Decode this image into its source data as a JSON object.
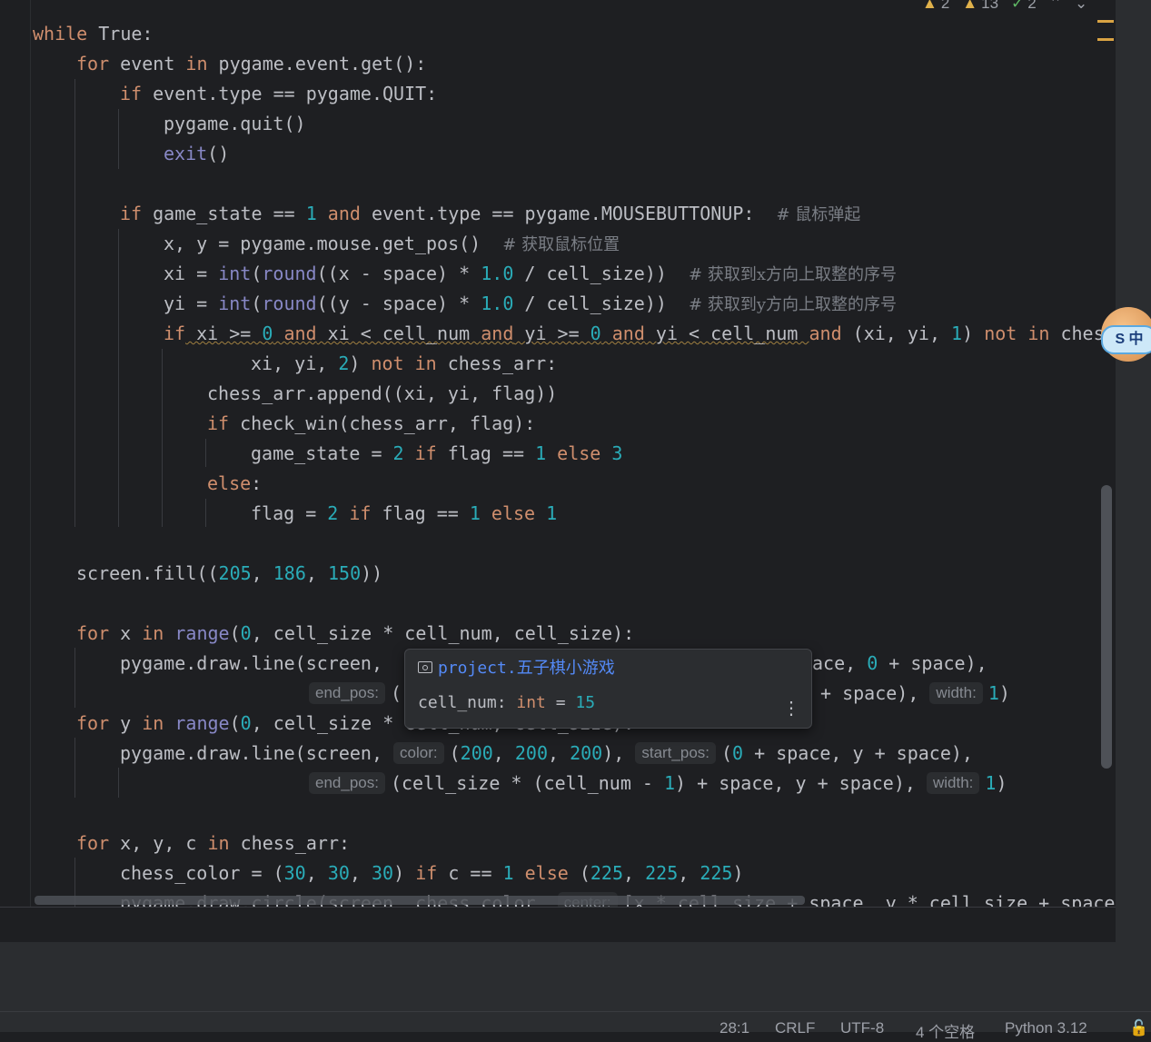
{
  "code": {
    "l1": {
      "kw": "while",
      "rest": " True:"
    },
    "l2": {
      "kw1": "for",
      "a": " event ",
      "kw2": "in",
      "b": " pygame.event.get():"
    },
    "l3": {
      "kw": "if",
      "rest": " event.type == pygame.QUIT:"
    },
    "l4": {
      "text": "pygame.quit()"
    },
    "l5": {
      "fn": "exit",
      "rest": "()"
    },
    "l6": {
      "kw": "if",
      "a": " game_state == ",
      "n": "1",
      "kw2": " and",
      "b": " event.type == pygame.MOUSEBUTTONUP:  ",
      "comment": "# 鼠标弹起"
    },
    "l7": {
      "text": "x, y = pygame.mouse.get_pos()  ",
      "comment": "# 获取鼠标位置"
    },
    "l8": {
      "a": "xi = ",
      "f1": "int",
      "p1": "(",
      "f2": "round",
      "b": "((x - space) * ",
      "n": "1.0",
      "c": " / cell_size))  ",
      "comment": "# 获取到x方向上取整的序号"
    },
    "l9": {
      "a": "yi = ",
      "f1": "int",
      "p1": "(",
      "f2": "round",
      "b": "((y - space) * ",
      "n": "1.0",
      "c": " / cell_size))  ",
      "comment": "# 获取到y方向上取整的序号"
    },
    "l10": {
      "kw": "if",
      "a": " xi >= ",
      "n0": "0",
      "kw2": " and",
      "b": " xi < cell_num ",
      "kw3": "and",
      "c": " yi >= ",
      "n1": "0",
      "kw4": " and",
      "d": " yi < cell_num ",
      "kw5": "and",
      "e": " (xi, yi, ",
      "n2": "1",
      "f": ") ",
      "kw6": "not in",
      "g": " ches"
    },
    "l11": {
      "a": "xi, yi, ",
      "n": "2",
      "b": ") ",
      "kw": "not in",
      "c": " chess_arr:"
    },
    "l12": {
      "text": "chess_arr.append((xi, yi, flag))"
    },
    "l13": {
      "kw": "if",
      "rest": " check_win(chess_arr, flag):"
    },
    "l14": {
      "a": "game_state = ",
      "n1": "2",
      "kw1": " if",
      "b": " flag == ",
      "n2": "1",
      "kw2": " else",
      "n3": " 3"
    },
    "l15": {
      "kw": "else",
      "rest": ":"
    },
    "l16": {
      "a": "flag = ",
      "n1": "2",
      "kw1": " if",
      "b": " flag == ",
      "n2": "1",
      "kw2": " else",
      "n3": " 1"
    },
    "l17": {
      "a": "screen.fill((",
      "n1": "205",
      "s1": ", ",
      "n2": "186",
      "s2": ", ",
      "n3": "150",
      "b": "))"
    },
    "l18": {
      "kw": "for",
      "a": " x ",
      "kw2": "in",
      "sp": " ",
      "fn": "range",
      "p": "(",
      "n": "0",
      "b": ", cell_size * cell_num, cell_size):"
    },
    "l19": {
      "a": "pygame.draw.line(screen, ",
      "tail": "ace, ",
      "n": "0",
      "b": " + space),"
    },
    "l20": {
      "hint": "end_pos:",
      "a": "(",
      "tail": "+ space), ",
      "hint2": "width:",
      "n": "1",
      "b": ")"
    },
    "l21": {
      "kw": "for",
      "a": " y ",
      "kw2": "in",
      "sp": " ",
      "fn": "range",
      "p": "(",
      "n": "0",
      "b": ", cell_size * ",
      "hidden": "cell_num, cell_size):"
    },
    "l22": {
      "a": "pygame.draw.line(screen, ",
      "hint1": "color:",
      "p": "(",
      "n1": "200",
      "s1": ", ",
      "n2": "200",
      "s2": ", ",
      "n3": "200",
      "b": "), ",
      "hint2": "start_pos:",
      "c": "(",
      "n4": "0",
      "d": " + space, y + space),"
    },
    "l23": {
      "hint1": "end_pos:",
      "a": "(cell_size * (cell_num - ",
      "n": "1",
      "b": ") + space, y + space), ",
      "hint2": "width:",
      "n2": "1",
      "c": ")"
    },
    "l24": {
      "kw": "for",
      "a": " x, y, c ",
      "kw2": "in",
      "b": " chess_arr:"
    },
    "l25": {
      "a": "chess_color = (",
      "n1": "30",
      "s1": ", ",
      "n2": "30",
      "s2": ", ",
      "n3": "30",
      "b": ") ",
      "kw1": "if",
      "c": " c == ",
      "n4": "1",
      "kw2": " else",
      "d": " (",
      "n5": "225",
      "s3": ", ",
      "n6": "225",
      "s4": ", ",
      "n7": "225",
      "e": ")"
    },
    "l26": {
      "a": "pygame.draw.circle(screen, chess_color, ",
      "hint": "center:",
      "b": "[x * cell_size + space, y * cell_size + space"
    }
  },
  "popup": {
    "package": "project.五子棋小游戏",
    "signature_name": "cell_num: ",
    "signature_type": "int",
    "signature_eq": " = ",
    "signature_value": "15",
    "more": "⋮"
  },
  "inspections": {
    "warnings": "2",
    "weak_warnings": "13",
    "typos": "2"
  },
  "status": {
    "position": "28:1",
    "line_sep": "CRLF",
    "encoding": "UTF-8",
    "indent": "4 个空格",
    "interpreter": "Python 3.12"
  },
  "ime": {
    "label": "S 中"
  }
}
